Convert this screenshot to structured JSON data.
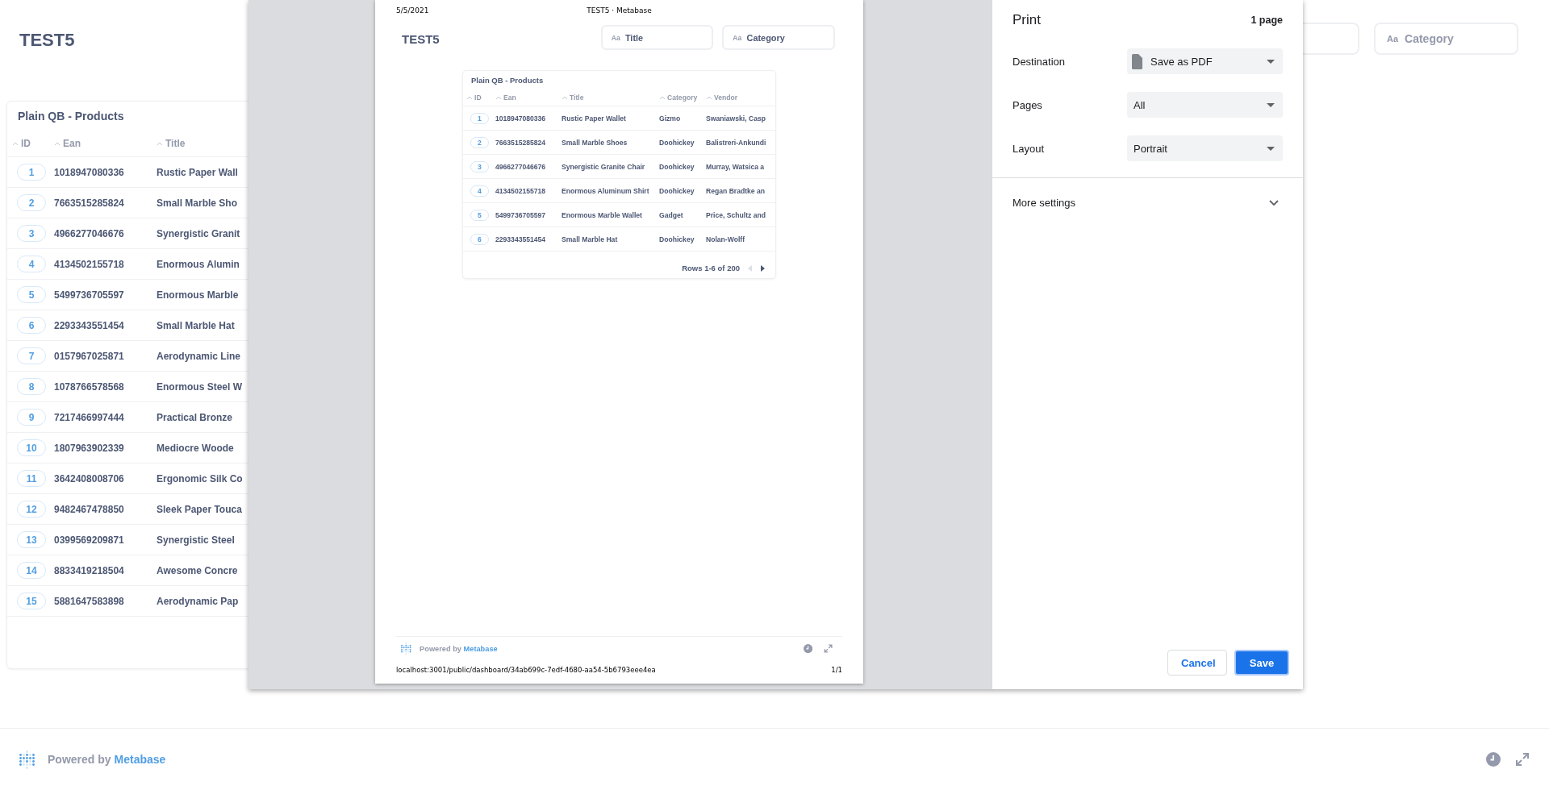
{
  "dashboard": {
    "title": "TEST5",
    "filters": [
      {
        "icon_text": "Aa",
        "label": "Category"
      }
    ],
    "card": {
      "title": "Plain QB - Products",
      "columns": [
        "ID",
        "Ean",
        "Title"
      ],
      "rows": [
        [
          "1",
          "1018947080336",
          "Rustic Paper Wall"
        ],
        [
          "2",
          "7663515285824",
          "Small Marble Sho"
        ],
        [
          "3",
          "4966277046676",
          "Synergistic Granit"
        ],
        [
          "4",
          "4134502155718",
          "Enormous Alumin"
        ],
        [
          "5",
          "5499736705597",
          "Enormous Marble"
        ],
        [
          "6",
          "2293343551454",
          "Small Marble Hat"
        ],
        [
          "7",
          "0157967025871",
          "Aerodynamic Line"
        ],
        [
          "8",
          "1078766578568",
          "Enormous Steel W"
        ],
        [
          "9",
          "7217466997444",
          "Practical Bronze"
        ],
        [
          "10",
          "1807963902339",
          "Mediocre Woode"
        ],
        [
          "11",
          "3642408008706",
          "Ergonomic Silk Co"
        ],
        [
          "12",
          "9482467478850",
          "Sleek Paper Touca"
        ],
        [
          "13",
          "0399569209871",
          "Synergistic Steel"
        ],
        [
          "14",
          "8833419218504",
          "Awesome Concre"
        ],
        [
          "15",
          "5881647583898",
          "Aerodynamic Pap"
        ]
      ]
    }
  },
  "footer": {
    "powered_by": "Powered by",
    "brand": "Metabase"
  },
  "print_preview": {
    "header_date": "5/5/2021",
    "header_title": "TEST5 · Metabase",
    "dashboard": {
      "title": "TEST5",
      "filters": [
        {
          "icon_text": "Aa",
          "label": "Title"
        },
        {
          "icon_text": "Aa",
          "label": "Category"
        }
      ],
      "card": {
        "title": "Plain QB - Products",
        "columns": [
          "ID",
          "Ean",
          "Title",
          "Category",
          "Vendor"
        ],
        "rows": [
          [
            "1",
            "1018947080336",
            "Rustic Paper Wallet",
            "Gizmo",
            "Swaniawski, Casp"
          ],
          [
            "2",
            "7663515285824",
            "Small Marble Shoes",
            "Doohickey",
            "Balistreri-Ankundi"
          ],
          [
            "3",
            "4966277046676",
            "Synergistic Granite Chair",
            "Doohickey",
            "Murray, Watsica a"
          ],
          [
            "4",
            "4134502155718",
            "Enormous Aluminum Shirt",
            "Doohickey",
            "Regan Bradtke an"
          ],
          [
            "5",
            "5499736705597",
            "Enormous Marble Wallet",
            "Gadget",
            "Price, Schultz and"
          ],
          [
            "6",
            "2293343551454",
            "Small Marble Hat",
            "Doohickey",
            "Nolan-Wolff"
          ]
        ],
        "pagination": {
          "text": "Rows 1-6 of 200",
          "prev_disabled": true,
          "next_disabled": false
        }
      }
    },
    "footer": {
      "powered_by": "Powered by",
      "brand": "Metabase"
    },
    "url": "localhost:3001/public/dashboard/34ab699c-7edf-4680-aa54-5b6793eee4ea",
    "page_number": "1/1"
  },
  "print_settings": {
    "title": "Print",
    "page_count": "1 page",
    "fields": [
      {
        "label": "Destination",
        "value": "Save as PDF",
        "kind": "destination"
      },
      {
        "label": "Pages",
        "value": "All",
        "kind": "select"
      },
      {
        "label": "Layout",
        "value": "Portrait",
        "kind": "select"
      }
    ],
    "more_settings": {
      "label": "More settings",
      "expanded": false
    },
    "buttons": [
      {
        "label": "Cancel",
        "kind": "secondary"
      },
      {
        "label": "Save",
        "kind": "primary"
      }
    ]
  }
}
